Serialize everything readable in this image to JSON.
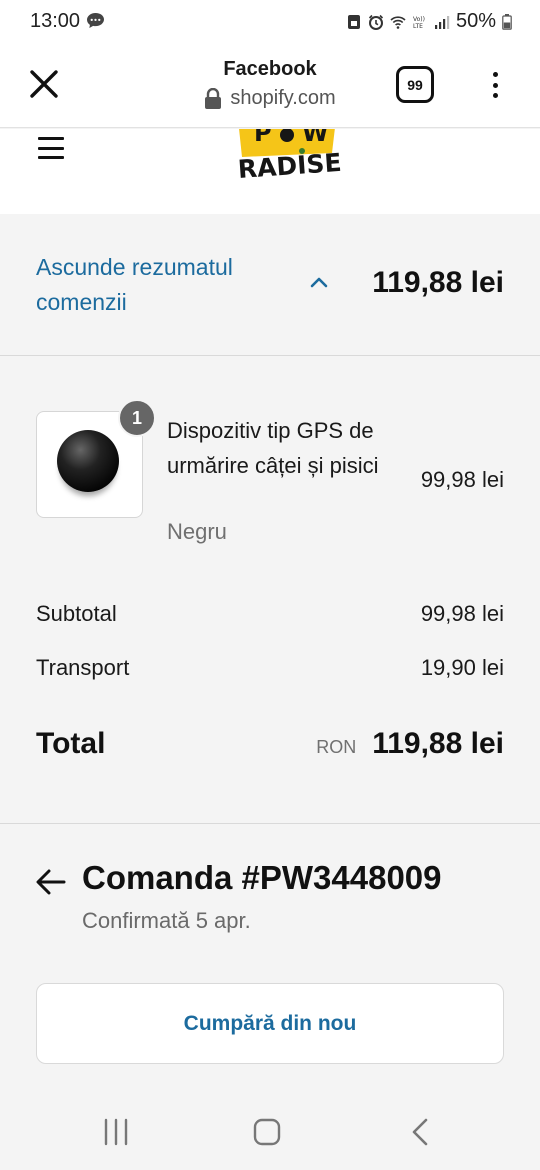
{
  "status_bar": {
    "time": "13:00",
    "battery": "50%",
    "icons": [
      "message-icon",
      "lock-screen-icon",
      "alarm-icon",
      "wifi-icon",
      "volte-icon",
      "signal-icon",
      "battery-icon"
    ]
  },
  "browser": {
    "title": "Facebook",
    "url": "shopify.com",
    "tab_count": "99",
    "icons": [
      "close-icon",
      "lock-icon",
      "more-vert-icon"
    ]
  },
  "site": {
    "logo_text": "PAW RADISE",
    "logo_colors": {
      "primary": "#f5c518",
      "secondary": "#161616",
      "accent": "#3a7d2c"
    }
  },
  "summary_toggle": {
    "label": "Ascunde rezumatul comenzii",
    "total": "119,88 lei"
  },
  "order": {
    "items": [
      {
        "name": "Dispozitiv tip GPS de urmărire câței și pisici",
        "variant": "Negru",
        "price": "99,98 lei",
        "quantity": "1"
      }
    ],
    "subtotal_label": "Subtotal",
    "subtotal_value": "99,98 lei",
    "shipping_label": "Transport",
    "shipping_value": "19,90 lei",
    "total_label": "Total",
    "total_currency": "RON",
    "total_value": "119,88 lei"
  },
  "order_status": {
    "title": "Comanda #PW3448009",
    "subtitle": "Confirmată 5 apr.",
    "buy_again_label": "Cumpără din nou"
  },
  "colors": {
    "accent_link": "#1c6b9e",
    "background": "#f4f4f4",
    "surface": "#ffffff"
  },
  "nav_bar": {
    "icons": [
      "recent-apps-icon",
      "home-icon",
      "back-icon"
    ]
  }
}
